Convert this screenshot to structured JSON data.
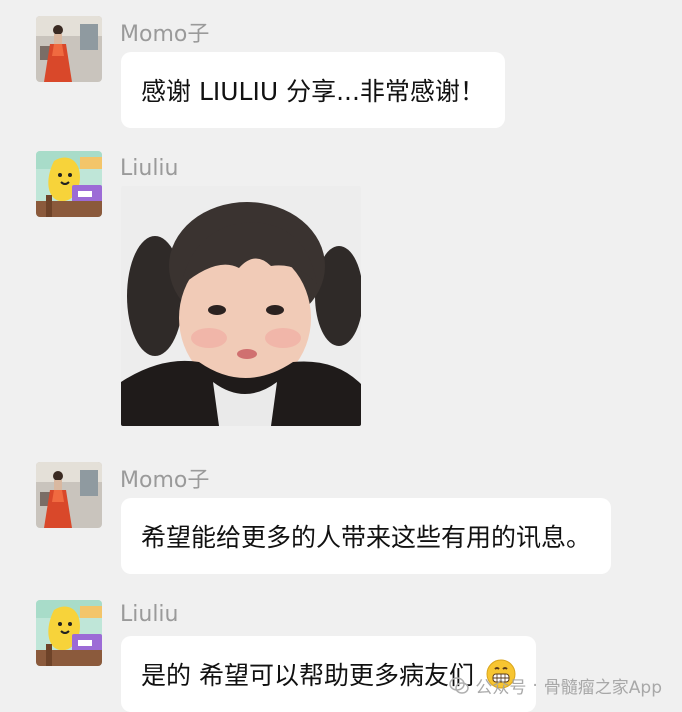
{
  "messages": [
    {
      "sender": "Momo子",
      "text": "感谢 LIULIU 分享...非常感谢！"
    },
    {
      "sender": "Liuliu",
      "image": "sticker-photo-girl-puffed-cheeks"
    },
    {
      "sender": "Momo子",
      "text": "希望能给更多的人带来这些有用的讯息。"
    },
    {
      "sender": "Liuliu",
      "text": "是的 希望可以帮助更多病友们"
    }
  ],
  "emoji": "grinning-face-icon",
  "watermark": {
    "prefix": "公众号",
    "separator": "·",
    "name": "骨髓瘤之家App"
  },
  "colors": {
    "background": "#f0f0f0",
    "bubble": "#ffffff",
    "sender_text": "#9a9a9a",
    "message_text": "#111111"
  }
}
